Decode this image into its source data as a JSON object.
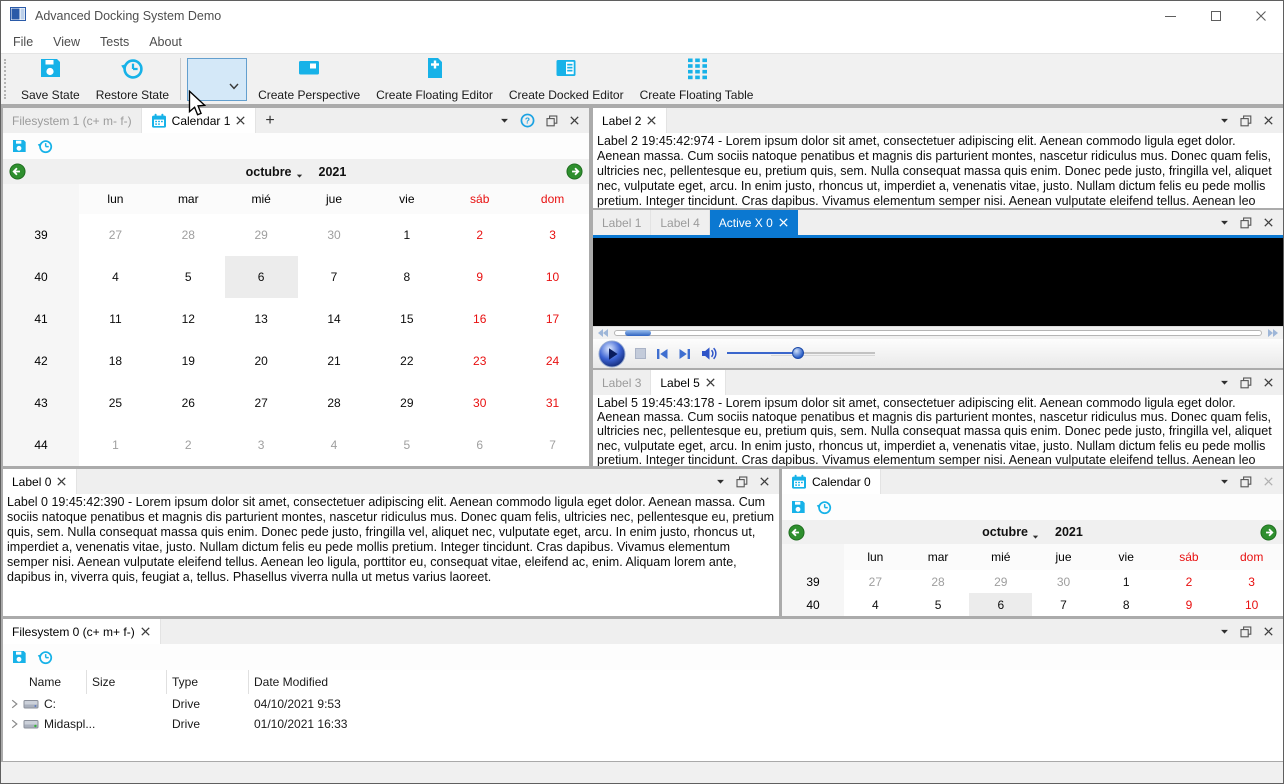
{
  "window": {
    "title": "Advanced Docking System Demo",
    "controls": [
      "minimize-icon",
      "maximize-icon",
      "close-icon"
    ]
  },
  "menu": {
    "items": [
      {
        "label": "File"
      },
      {
        "label": "View"
      },
      {
        "label": "Tests"
      },
      {
        "label": "About"
      }
    ]
  },
  "toolbar": {
    "items": [
      {
        "type": "button",
        "icon": "save-state-icon",
        "label": "Save State"
      },
      {
        "type": "button",
        "icon": "restore-state-icon",
        "label": "Restore State"
      },
      {
        "type": "separator"
      },
      {
        "type": "combo",
        "name": "perspective-combobox",
        "value": "",
        "state": "hovered"
      },
      {
        "type": "button",
        "icon": "create-perspective-icon",
        "label": "Create Perspective"
      },
      {
        "type": "button",
        "icon": "create-floating-editor-icon",
        "label": "Create Floating Editor"
      },
      {
        "type": "button",
        "icon": "create-docked-editor-icon",
        "label": "Create Docked Editor"
      },
      {
        "type": "button",
        "icon": "create-floating-table-icon",
        "label": "Create Floating Table"
      }
    ]
  },
  "colors": {
    "icon_cyan": "#17b2e8",
    "accent_blue": "#0b78d1",
    "weekend_red": "#e81010",
    "muted_gray": "#9f9f9f",
    "nav_green": "#2e8f2e",
    "selection_bg": "#ececec"
  },
  "icons_legend": {
    "menu-arrow-icon": "small black triangle pointing down",
    "help-icon": "blue circled question mark",
    "undock-icon": "two overlapping squares (float window)",
    "close-icon": "x cross",
    "save-icon": "blue floppy disk",
    "history-icon": "blue clock with undo arrow",
    "calendar-icon": "blue calendar page",
    "drive-icon": "hard drive",
    "expand-chevron-icon": "right angle chevron"
  },
  "calendar": {
    "month": "octubre",
    "year": "2021",
    "day_headers": [
      {
        "label": "lun"
      },
      {
        "label": "mar"
      },
      {
        "label": "mié"
      },
      {
        "label": "jue"
      },
      {
        "label": "vie"
      },
      {
        "label": "sáb",
        "weekend": true
      },
      {
        "label": "dom",
        "weekend": true
      }
    ],
    "weeks": [
      {
        "num": "39",
        "days": [
          {
            "v": "27",
            "muted": true
          },
          {
            "v": "28",
            "muted": true
          },
          {
            "v": "29",
            "muted": true
          },
          {
            "v": "30",
            "muted": true
          },
          {
            "v": "1"
          },
          {
            "v": "2",
            "red": true
          },
          {
            "v": "3",
            "red": true
          }
        ]
      },
      {
        "num": "40",
        "days": [
          {
            "v": "4"
          },
          {
            "v": "5"
          },
          {
            "v": "6",
            "selected": true
          },
          {
            "v": "7"
          },
          {
            "v": "8"
          },
          {
            "v": "9",
            "red": true
          },
          {
            "v": "10",
            "red": true
          }
        ]
      },
      {
        "num": "41",
        "days": [
          {
            "v": "11"
          },
          {
            "v": "12"
          },
          {
            "v": "13"
          },
          {
            "v": "14"
          },
          {
            "v": "15"
          },
          {
            "v": "16",
            "red": true
          },
          {
            "v": "17",
            "red": true
          }
        ]
      },
      {
        "num": "42",
        "days": [
          {
            "v": "18"
          },
          {
            "v": "19"
          },
          {
            "v": "20"
          },
          {
            "v": "21"
          },
          {
            "v": "22"
          },
          {
            "v": "23",
            "red": true
          },
          {
            "v": "24",
            "red": true
          }
        ]
      },
      {
        "num": "43",
        "days": [
          {
            "v": "25"
          },
          {
            "v": "26"
          },
          {
            "v": "27"
          },
          {
            "v": "28"
          },
          {
            "v": "29"
          },
          {
            "v": "30",
            "red": true
          },
          {
            "v": "31",
            "red": true
          }
        ]
      },
      {
        "num": "44",
        "days": [
          {
            "v": "1",
            "muted": true
          },
          {
            "v": "2",
            "muted": true
          },
          {
            "v": "3",
            "muted": true
          },
          {
            "v": "4",
            "muted": true
          },
          {
            "v": "5",
            "muted": true
          },
          {
            "v": "6",
            "muted": true
          },
          {
            "v": "7",
            "muted": true
          }
        ]
      }
    ]
  },
  "panels": {
    "calendar1": {
      "tabs": [
        {
          "label": "Filesystem 1 (c+ m- f-)"
        },
        {
          "label": "Calendar 1",
          "active": true,
          "icon": "calendar-icon",
          "closable": true
        },
        {
          "label": "+",
          "add": true
        }
      ],
      "title_buttons": [
        {
          "icon": "menu-arrow-icon"
        },
        {
          "icon": "help-icon"
        },
        {
          "icon": "undock-icon"
        },
        {
          "icon": "close-icon"
        }
      ],
      "toolbar_icons": [
        "save-icon",
        "history-icon"
      ]
    },
    "label2": {
      "tabs": [
        {
          "label": "Label 2",
          "active": true,
          "closable": true
        }
      ],
      "title_buttons": [
        {
          "icon": "menu-arrow-icon"
        },
        {
          "icon": "undock-icon"
        },
        {
          "icon": "close-icon"
        }
      ],
      "text": "Label 2 19:45:42:974 - Lorem ipsum dolor sit amet, consectetuer adipiscing elit. Aenean commodo ligula eget dolor. Aenean massa. Cum sociis natoque penatibus et magnis dis parturient montes, nascetur ridiculus mus. Donec quam felis, ultricies nec, pellentesque eu, pretium quis, sem. Nulla consequat massa quis enim. Donec pede justo, fringilla vel, aliquet nec, vulputate eget, arcu. In enim justo, rhoncus ut, imperdiet a, venenatis vitae, justo. Nullam dictum felis eu pede mollis pretium. Integer tincidunt. Cras dapibus. Vivamus elementum semper nisi. Aenean vulputate eleifend tellus. Aenean leo ligula, porttitor eu, consequat vitae, eleifend ac, enim. Aliquam"
    },
    "activex": {
      "tabs": [
        {
          "label": "Label 1"
        },
        {
          "label": "Label 4"
        },
        {
          "label": "Active X 0",
          "active": true,
          "accent": true,
          "closable": true
        }
      ],
      "title_buttons": [
        {
          "icon": "menu-arrow-icon"
        },
        {
          "icon": "undock-icon"
        },
        {
          "icon": "close-icon"
        }
      ],
      "media": {
        "controls": [
          "seek-back-icon",
          "seek-slider",
          "seek-forward-icon",
          "play-button",
          "stop-button",
          "previous-button",
          "next-button",
          "volume-icon",
          "volume-slider"
        ],
        "seek_value_pct": 2,
        "volume_value_pct": 48
      }
    },
    "label5": {
      "tabs": [
        {
          "label": "Label 3"
        },
        {
          "label": "Label 5",
          "active": true,
          "closable": true
        }
      ],
      "title_buttons": [
        {
          "icon": "menu-arrow-icon"
        },
        {
          "icon": "undock-icon"
        },
        {
          "icon": "close-icon"
        }
      ],
      "text": "Label 5 19:45:43:178 - Lorem ipsum dolor sit amet, consectetuer adipiscing elit. Aenean commodo ligula eget dolor. Aenean massa. Cum sociis natoque penatibus et magnis dis parturient montes, nascetur ridiculus mus. Donec quam felis, ultricies nec, pellentesque eu, pretium quis, sem. Nulla consequat massa quis enim. Donec pede justo, fringilla vel, aliquet nec, vulputate eget, arcu. In enim justo, rhoncus ut, imperdiet a, venenatis vitae, justo. Nullam dictum felis eu pede mollis pretium. Integer tincidunt. Cras dapibus. Vivamus elementum semper nisi. Aenean vulputate eleifend tellus. Aenean leo ligula, porttitor eu, consequat vitae, eleifend ac, enim. Aliquam"
    },
    "label0": {
      "tabs": [
        {
          "label": "Label 0",
          "active": true,
          "closable": true
        }
      ],
      "title_buttons": [
        {
          "icon": "menu-arrow-icon"
        },
        {
          "icon": "undock-icon"
        },
        {
          "icon": "close-icon"
        }
      ],
      "text": "Label 0 19:45:42:390 - Lorem ipsum dolor sit amet, consectetuer adipiscing elit. Aenean commodo ligula eget dolor. Aenean massa. Cum sociis natoque penatibus et magnis dis parturient montes, nascetur ridiculus mus. Donec quam felis, ultricies nec, pellentesque eu, pretium quis, sem. Nulla consequat massa quis enim. Donec pede justo, fringilla vel, aliquet nec, vulputate eget, arcu. In enim justo, rhoncus ut, imperdiet a, venenatis vitae, justo. Nullam dictum felis eu pede mollis pretium. Integer tincidunt. Cras dapibus. Vivamus elementum semper nisi. Aenean vulputate eleifend tellus. Aenean leo ligula, porttitor eu, consequat vitae, eleifend ac, enim. Aliquam lorem ante, dapibus in, viverra quis, feugiat a, tellus. Phasellus viverra nulla ut metus varius laoreet."
    },
    "calendar0": {
      "tabs": [
        {
          "label": "Calendar 0",
          "active": true,
          "icon": "calendar-icon"
        }
      ],
      "title_buttons": [
        {
          "icon": "menu-arrow-icon"
        },
        {
          "icon": "undock-icon"
        },
        {
          "icon": "close-icon",
          "dimmed": true
        }
      ],
      "toolbar_icons": [
        "save-icon",
        "history-icon"
      ]
    },
    "filesystem0": {
      "tabs": [
        {
          "label": "Filesystem 0 (c+ m+ f-)",
          "active": true,
          "closable": true
        }
      ],
      "title_buttons": [
        {
          "icon": "menu-arrow-icon"
        },
        {
          "icon": "undock-icon"
        },
        {
          "icon": "close-icon"
        }
      ],
      "toolbar_icons": [
        "save-icon",
        "history-icon"
      ],
      "columns": [
        {
          "label": "Name"
        },
        {
          "label": "Size"
        },
        {
          "label": "Type"
        },
        {
          "label": "Date Modified"
        }
      ],
      "rows": [
        {
          "name": "C:",
          "size": "",
          "type": "Drive",
          "date_modified": "04/10/2021 9:53",
          "icon": "drive-icon"
        },
        {
          "name": "Midaspl...",
          "size": "",
          "type": "Drive",
          "date_modified": "01/10/2021 16:33",
          "icon": "drive-icon-green"
        }
      ]
    }
  },
  "statusbar": {
    "text": ""
  }
}
